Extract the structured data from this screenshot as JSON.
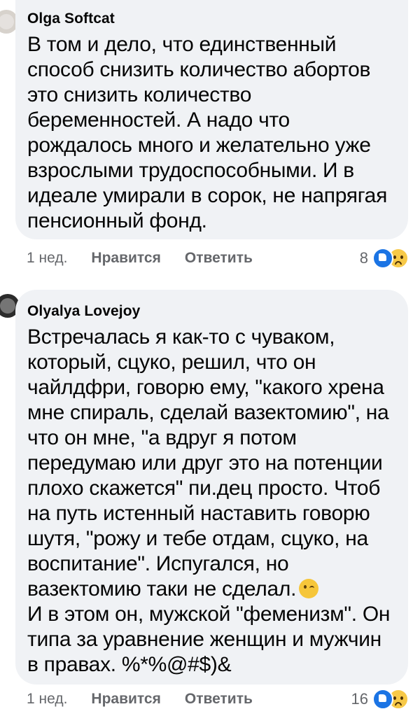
{
  "comments": [
    {
      "author": "Olga Softcat",
      "text": "В том и дело, что единственный\nспособ снизить количество абортов\nэто снизить количество\nбеременностей. А надо что\nрождалось много и желательно уже\nвзрослыми трудоспособными. И в\nидеале умирали в сорок, не напрягая\nпенсионный фонд.",
      "time": "1 нед.",
      "like_label": "Нравится",
      "reply_label": "Ответить",
      "reaction_count": "8",
      "reactions": [
        "like-icon",
        "sad-icon"
      ]
    },
    {
      "author": "Olyalya Lovejoy",
      "text_part1": "Встречалась я как-то с чуваком,\nкоторый, сцуко, решил, что он\nчайлдфри, говорю ему, \"какого хрена\nмне спираль, сделай вазектомию\", на\nчто он мне, \"а вдруг я потом\nпередумаю или друг это на потенции\nплохо скажется\" пи.дец просто. Чтоб\nна путь истенный наставить говорю\nшутя, \"рожу и тебе отдам, сцуко, на\nвоспитание\". Испугался, но\nвазектомию таки не сделал.",
      "emoji": "wink-emoji",
      "text_part2": "И в этом он, мужской \"феменизм\". Он\nтипа за уравнение женщин и мужчин\nв правах. %*%@#$)&",
      "time": "1 нед.",
      "like_label": "Нравится",
      "reply_label": "Ответить",
      "reaction_count": "16",
      "reactions": [
        "like-icon",
        "sad-icon"
      ]
    }
  ],
  "colors": {
    "bubble": "#f0f2f5",
    "meta_text": "#65676b",
    "like_blue": "#1b74e4"
  }
}
